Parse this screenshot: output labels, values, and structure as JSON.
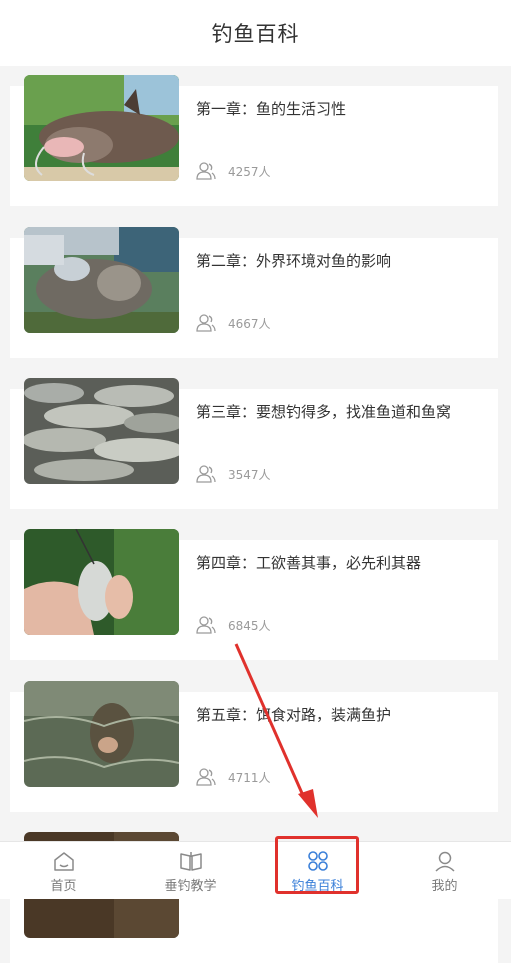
{
  "header": {
    "title": "钓鱼百科"
  },
  "chapters": [
    {
      "title": "第一章：鱼的生活习性",
      "count": "4257人"
    },
    {
      "title": "第二章：外界环境对鱼的影响",
      "count": "4667人"
    },
    {
      "title": "第三章：要想钓得多，找准鱼道和鱼窝",
      "count": "3547人"
    },
    {
      "title": "第四章：工欲善其事，必先利其器",
      "count": "6845人"
    },
    {
      "title": "第五章：饵食对路，装满鱼护",
      "count": "4711人"
    }
  ],
  "tabbar": {
    "tabs": [
      {
        "label": "首页",
        "icon": "home-icon"
      },
      {
        "label": "垂钓教学",
        "icon": "book-icon"
      },
      {
        "label": "钓鱼百科",
        "icon": "clover-icon",
        "active": true
      },
      {
        "label": "我的",
        "icon": "user-icon"
      }
    ]
  },
  "colors": {
    "accent": "#3a7fd8",
    "annotation": "#e0312c"
  }
}
